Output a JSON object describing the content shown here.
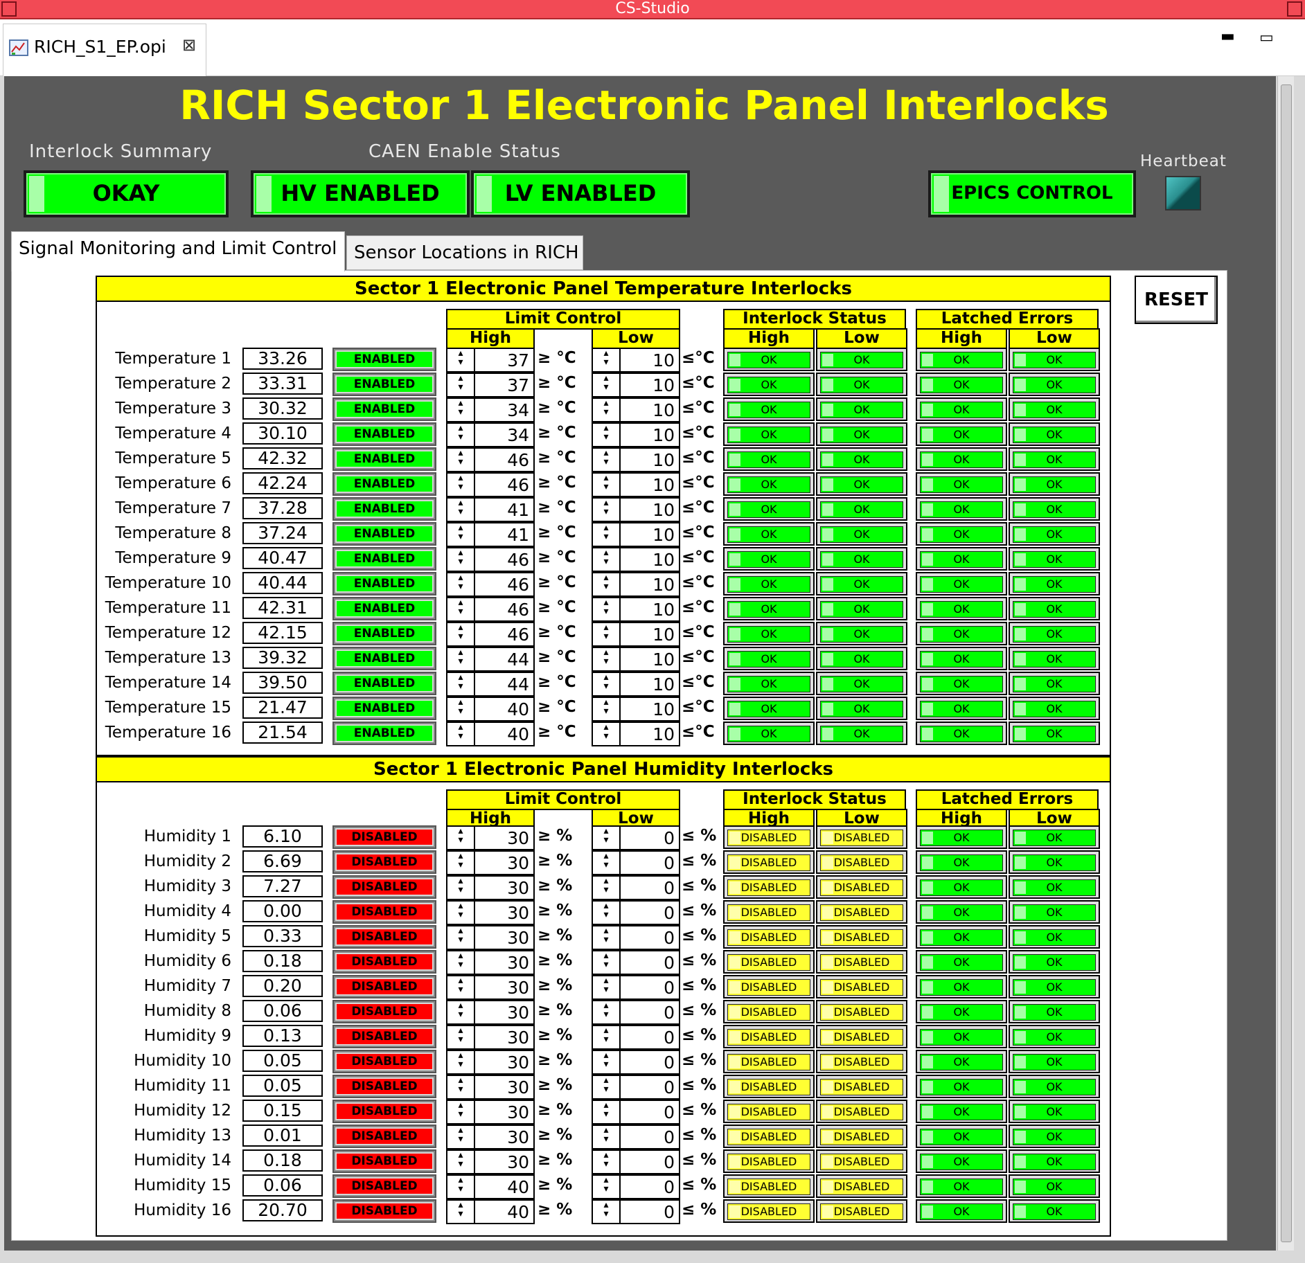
{
  "window": {
    "title": "CS-Studio"
  },
  "editor_tab": {
    "label": "RICH_S1_EP.opi",
    "close": "⊠"
  },
  "main_title": "RICH Sector 1 Electronic Panel Interlocks",
  "interlock_summary": {
    "label": "Interlock Summary",
    "value": "OKAY"
  },
  "caen": {
    "label": "CAEN Enable Status",
    "hv": "HV ENABLED",
    "lv": "LV ENABLED"
  },
  "epics": {
    "label": "EPICS CONTROL"
  },
  "heartbeat": {
    "label": "Heartbeat"
  },
  "tabs": [
    {
      "label": "Signal Monitoring and Limit Control"
    },
    {
      "label": "Sensor Locations in RICH"
    }
  ],
  "reset": {
    "label": "RESET"
  },
  "colors": {
    "accent_yellow": "#ffff00",
    "ok_green": "#00ff00",
    "disabled_red": "#ff0000",
    "canvas_gray": "#5a5a5a",
    "titlebar_red": "#f24a55"
  },
  "temperature": {
    "title": "Sector 1 Electronic Panel Temperature Interlocks",
    "headers": {
      "limit_control": "Limit Control",
      "interlock_status": "Interlock Status",
      "latched_errors": "Latched Errors",
      "high": "High",
      "low": "Low"
    },
    "unit_high": "≥ °C",
    "unit_low": "≤°C",
    "rows": [
      {
        "label": "Temperature 1",
        "value": "33.26",
        "enable": "ENABLED",
        "high": "37",
        "low": "10",
        "st_high": "OK",
        "st_low": "OK",
        "le_high": "OK",
        "le_low": "OK"
      },
      {
        "label": "Temperature 2",
        "value": "33.31",
        "enable": "ENABLED",
        "high": "37",
        "low": "10",
        "st_high": "OK",
        "st_low": "OK",
        "le_high": "OK",
        "le_low": "OK"
      },
      {
        "label": "Temperature 3",
        "value": "30.32",
        "enable": "ENABLED",
        "high": "34",
        "low": "10",
        "st_high": "OK",
        "st_low": "OK",
        "le_high": "OK",
        "le_low": "OK"
      },
      {
        "label": "Temperature 4",
        "value": "30.10",
        "enable": "ENABLED",
        "high": "34",
        "low": "10",
        "st_high": "OK",
        "st_low": "OK",
        "le_high": "OK",
        "le_low": "OK"
      },
      {
        "label": "Temperature 5",
        "value": "42.32",
        "enable": "ENABLED",
        "high": "46",
        "low": "10",
        "st_high": "OK",
        "st_low": "OK",
        "le_high": "OK",
        "le_low": "OK"
      },
      {
        "label": "Temperature 6",
        "value": "42.24",
        "enable": "ENABLED",
        "high": "46",
        "low": "10",
        "st_high": "OK",
        "st_low": "OK",
        "le_high": "OK",
        "le_low": "OK"
      },
      {
        "label": "Temperature 7",
        "value": "37.28",
        "enable": "ENABLED",
        "high": "41",
        "low": "10",
        "st_high": "OK",
        "st_low": "OK",
        "le_high": "OK",
        "le_low": "OK"
      },
      {
        "label": "Temperature 8",
        "value": "37.24",
        "enable": "ENABLED",
        "high": "41",
        "low": "10",
        "st_high": "OK",
        "st_low": "OK",
        "le_high": "OK",
        "le_low": "OK"
      },
      {
        "label": "Temperature 9",
        "value": "40.47",
        "enable": "ENABLED",
        "high": "46",
        "low": "10",
        "st_high": "OK",
        "st_low": "OK",
        "le_high": "OK",
        "le_low": "OK"
      },
      {
        "label": "Temperature 10",
        "value": "40.44",
        "enable": "ENABLED",
        "high": "46",
        "low": "10",
        "st_high": "OK",
        "st_low": "OK",
        "le_high": "OK",
        "le_low": "OK"
      },
      {
        "label": "Temperature 11",
        "value": "42.31",
        "enable": "ENABLED",
        "high": "46",
        "low": "10",
        "st_high": "OK",
        "st_low": "OK",
        "le_high": "OK",
        "le_low": "OK"
      },
      {
        "label": "Temperature 12",
        "value": "42.15",
        "enable": "ENABLED",
        "high": "46",
        "low": "10",
        "st_high": "OK",
        "st_low": "OK",
        "le_high": "OK",
        "le_low": "OK"
      },
      {
        "label": "Temperature 13",
        "value": "39.32",
        "enable": "ENABLED",
        "high": "44",
        "low": "10",
        "st_high": "OK",
        "st_low": "OK",
        "le_high": "OK",
        "le_low": "OK"
      },
      {
        "label": "Temperature 14",
        "value": "39.50",
        "enable": "ENABLED",
        "high": "44",
        "low": "10",
        "st_high": "OK",
        "st_low": "OK",
        "le_high": "OK",
        "le_low": "OK"
      },
      {
        "label": "Temperature 15",
        "value": "21.47",
        "enable": "ENABLED",
        "high": "40",
        "low": "10",
        "st_high": "OK",
        "st_low": "OK",
        "le_high": "OK",
        "le_low": "OK"
      },
      {
        "label": "Temperature 16",
        "value": "21.54",
        "enable": "ENABLED",
        "high": "40",
        "low": "10",
        "st_high": "OK",
        "st_low": "OK",
        "le_high": "OK",
        "le_low": "OK"
      }
    ]
  },
  "humidity": {
    "title": "Sector 1 Electronic Panel Humidity Interlocks",
    "headers": {
      "limit_control": "Limit Control",
      "interlock_status": "Interlock Status",
      "latched_errors": "Latched Errors",
      "high": "High",
      "low": "Low"
    },
    "unit_high": "≥ %",
    "unit_low": "≤ %",
    "rows": [
      {
        "label": "Humidity 1",
        "value": "6.10",
        "enable": "DISABLED",
        "high": "30",
        "low": "0",
        "st_high": "DISABLED",
        "st_low": "DISABLED",
        "le_high": "OK",
        "le_low": "OK"
      },
      {
        "label": "Humidity 2",
        "value": "6.69",
        "enable": "DISABLED",
        "high": "30",
        "low": "0",
        "st_high": "DISABLED",
        "st_low": "DISABLED",
        "le_high": "OK",
        "le_low": "OK"
      },
      {
        "label": "Humidity 3",
        "value": "7.27",
        "enable": "DISABLED",
        "high": "30",
        "low": "0",
        "st_high": "DISABLED",
        "st_low": "DISABLED",
        "le_high": "OK",
        "le_low": "OK"
      },
      {
        "label": "Humidity 4",
        "value": "0.00",
        "enable": "DISABLED",
        "high": "30",
        "low": "0",
        "st_high": "DISABLED",
        "st_low": "DISABLED",
        "le_high": "OK",
        "le_low": "OK"
      },
      {
        "label": "Humidity 5",
        "value": "0.33",
        "enable": "DISABLED",
        "high": "30",
        "low": "0",
        "st_high": "DISABLED",
        "st_low": "DISABLED",
        "le_high": "OK",
        "le_low": "OK"
      },
      {
        "label": "Humidity 6",
        "value": "0.18",
        "enable": "DISABLED",
        "high": "30",
        "low": "0",
        "st_high": "DISABLED",
        "st_low": "DISABLED",
        "le_high": "OK",
        "le_low": "OK"
      },
      {
        "label": "Humidity 7",
        "value": "0.20",
        "enable": "DISABLED",
        "high": "30",
        "low": "0",
        "st_high": "DISABLED",
        "st_low": "DISABLED",
        "le_high": "OK",
        "le_low": "OK"
      },
      {
        "label": "Humidity 8",
        "value": "0.06",
        "enable": "DISABLED",
        "high": "30",
        "low": "0",
        "st_high": "DISABLED",
        "st_low": "DISABLED",
        "le_high": "OK",
        "le_low": "OK"
      },
      {
        "label": "Humidity 9",
        "value": "0.13",
        "enable": "DISABLED",
        "high": "30",
        "low": "0",
        "st_high": "DISABLED",
        "st_low": "DISABLED",
        "le_high": "OK",
        "le_low": "OK"
      },
      {
        "label": "Humidity 10",
        "value": "0.05",
        "enable": "DISABLED",
        "high": "30",
        "low": "0",
        "st_high": "DISABLED",
        "st_low": "DISABLED",
        "le_high": "OK",
        "le_low": "OK"
      },
      {
        "label": "Humidity 11",
        "value": "0.05",
        "enable": "DISABLED",
        "high": "30",
        "low": "0",
        "st_high": "DISABLED",
        "st_low": "DISABLED",
        "le_high": "OK",
        "le_low": "OK"
      },
      {
        "label": "Humidity 12",
        "value": "0.15",
        "enable": "DISABLED",
        "high": "30",
        "low": "0",
        "st_high": "DISABLED",
        "st_low": "DISABLED",
        "le_high": "OK",
        "le_low": "OK"
      },
      {
        "label": "Humidity 13",
        "value": "0.01",
        "enable": "DISABLED",
        "high": "30",
        "low": "0",
        "st_high": "DISABLED",
        "st_low": "DISABLED",
        "le_high": "OK",
        "le_low": "OK"
      },
      {
        "label": "Humidity 14",
        "value": "0.18",
        "enable": "DISABLED",
        "high": "30",
        "low": "0",
        "st_high": "DISABLED",
        "st_low": "DISABLED",
        "le_high": "OK",
        "le_low": "OK"
      },
      {
        "label": "Humidity 15",
        "value": "0.06",
        "enable": "DISABLED",
        "high": "40",
        "low": "0",
        "st_high": "DISABLED",
        "st_low": "DISABLED",
        "le_high": "OK",
        "le_low": "OK"
      },
      {
        "label": "Humidity 16",
        "value": "20.70",
        "enable": "DISABLED",
        "high": "40",
        "low": "0",
        "st_high": "DISABLED",
        "st_low": "DISABLED",
        "le_high": "OK",
        "le_low": "OK"
      }
    ]
  }
}
